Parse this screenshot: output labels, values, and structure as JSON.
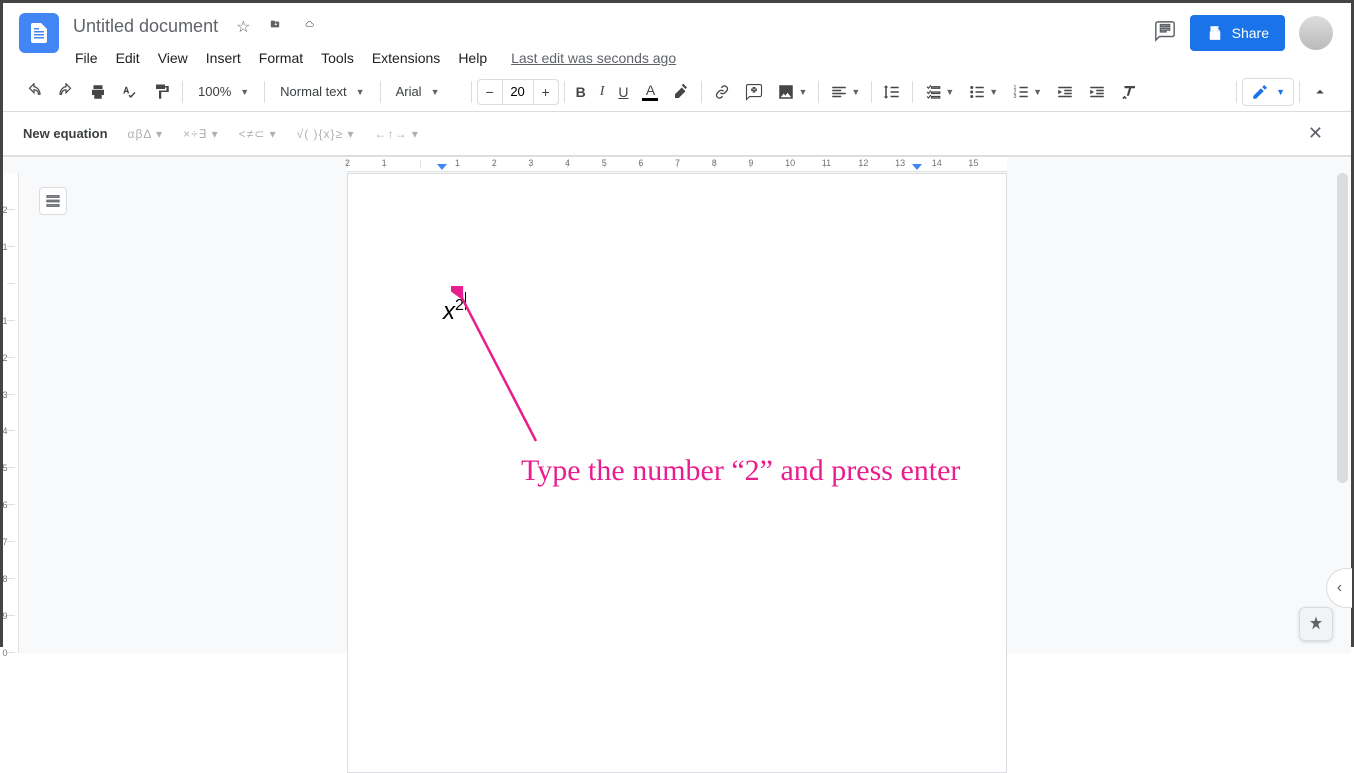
{
  "header": {
    "doc_title": "Untitled document",
    "menu": {
      "file": "File",
      "edit": "Edit",
      "view": "View",
      "insert": "Insert",
      "format": "Format",
      "tools": "Tools",
      "extensions": "Extensions",
      "help": "Help"
    },
    "last_edit": "Last edit was seconds ago",
    "share_label": "Share"
  },
  "toolbar": {
    "zoom": "100%",
    "style": "Normal text",
    "font": "Arial",
    "font_size": "20"
  },
  "equation_bar": {
    "new_equation": "New equation",
    "greek": "αβΔ ▾",
    "ops": "×÷∃ ▾",
    "rel": "<≠⊂ ▾",
    "fn": "√( ){x}≥ ▾",
    "arrows": "←↑→ ▾"
  },
  "ruler_h": [
    "2",
    "1",
    "",
    "1",
    "2",
    "3",
    "4",
    "5",
    "6",
    "7",
    "8",
    "9",
    "10",
    "11",
    "12",
    "13",
    "14",
    "15"
  ],
  "ruler_v": [
    "2",
    "1",
    "",
    "1",
    "2",
    "3",
    "4",
    "5",
    "6",
    "7",
    "8",
    "9",
    "0"
  ],
  "equation_content": {
    "base": "x",
    "exp": "2"
  },
  "annotation": "Type the number “2” and press enter"
}
